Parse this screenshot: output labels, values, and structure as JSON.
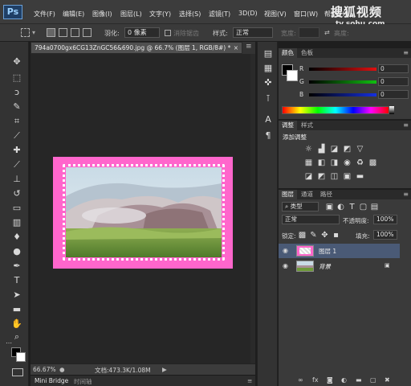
{
  "app": {
    "logo": "Ps",
    "menu": [
      "文件(F)",
      "编辑(E)",
      "图像(I)",
      "图层(L)",
      "文字(Y)",
      "选择(S)",
      "滤镜(T)",
      "3D(D)",
      "视图(V)",
      "窗口(W)",
      "帮助(H)"
    ],
    "watermark": {
      "name": "搜狐视频",
      "url": "tv.sohu.com"
    }
  },
  "options_bar": {
    "feather_label": "羽化:",
    "feather_value": "0 像素",
    "antialias_label": "消除锯齿",
    "style_label": "样式:",
    "style_value": "正常",
    "width_label": "宽度:",
    "height_label": "高度:"
  },
  "document": {
    "tab_title": "794a0700gx6CG13ZnGC56&690.jpg @ 66.7% (图层 1, RGB/8#) *",
    "close_glyph": "×",
    "zoom": "66.67%",
    "doc_info": "文档:473.3K/1.08M",
    "frame_color": "#ff66cc"
  },
  "bottom_tabs": [
    "Mini Bridge",
    "时间轴"
  ],
  "color_panel": {
    "tabs": [
      "颜色",
      "色板"
    ],
    "channels": [
      {
        "label": "R",
        "value": "0",
        "color": "#cc2222"
      },
      {
        "label": "G",
        "value": "0",
        "color": "#22aa22"
      },
      {
        "label": "B",
        "value": "0",
        "color": "#2233cc"
      }
    ]
  },
  "adjust_panel": {
    "tabs": [
      "调整",
      "样式"
    ],
    "title": "添加调整"
  },
  "layers_panel": {
    "tabs": [
      "图层",
      "通道",
      "路径"
    ],
    "kind_label": "类型",
    "blend_mode": "正常",
    "opacity_label": "不透明度:",
    "opacity_value": "100%",
    "lock_label": "锁定:",
    "fill_label": "填充:",
    "fill_value": "100%",
    "layers": [
      {
        "name": "图层 1",
        "selected": true,
        "locked": false
      },
      {
        "name": "背景",
        "selected": false,
        "locked": true
      }
    ]
  },
  "icons": {
    "menu_glyph": "≡",
    "dropdown": "▾",
    "eye": "◉",
    "lock": "🔒"
  }
}
